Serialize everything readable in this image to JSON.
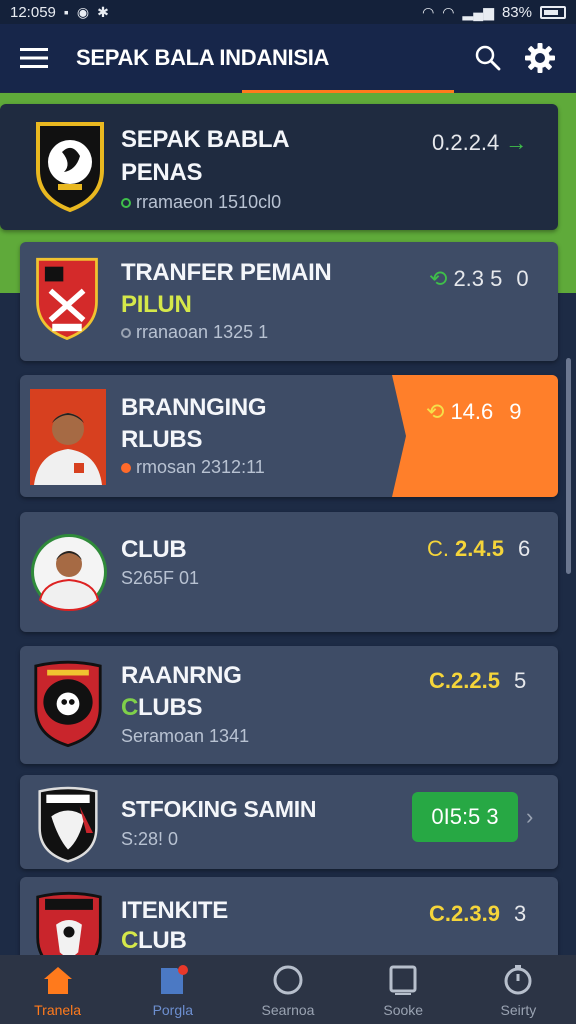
{
  "status_bar": {
    "time": "12:059",
    "battery": "83%"
  },
  "app_bar": {
    "title": "SEPAK BALA INDANISIA",
    "menu_icon": "hamburger-menu-icon",
    "search_icon": "search-icon",
    "settings_icon": "gear-icon"
  },
  "items": [
    {
      "name1": "SEPAK BABLA",
      "name2": "PENAS",
      "sub": "rramaeon 1510cl0",
      "score_a": "0.2.2.4",
      "score_b": "",
      "dot_color": "#3fbf4a",
      "badge": "black-gold-club-badge-icon"
    },
    {
      "name1": "TRANFER PEMAIN",
      "name2": "PILUN",
      "sub": "rranaoan 1325 1",
      "score_a": "2.3 5",
      "score_b": "0",
      "dot_color": "#9aa3b2",
      "badge": "red-shield-badge-icon"
    },
    {
      "name1": "BRANNGING",
      "name2": "RLUBS",
      "sub": "rmosan 2312:11",
      "score_a": "14.6",
      "score_b": "9",
      "dot_color": "#ff6a2a",
      "badge": "player-portrait-icon"
    },
    {
      "name1": "CLUB",
      "name2": "",
      "sub": "S265F 01",
      "score_a": "2.4.5",
      "score_b": "6",
      "dot_color": "",
      "badge": "player-portrait-icon"
    },
    {
      "name1": "RAANRNG",
      "name2": "CLUBS",
      "sub": "Seramoan 1341",
      "score_a": "C.2.2.5",
      "score_b": "5",
      "dot_color": "",
      "badge": "skull-club-badge-icon"
    },
    {
      "name1": "STFOKING SAMIN",
      "name2": "",
      "sub": "S:28! 0",
      "score_a": "0I5:5 3",
      "score_b": "",
      "dot_color": "",
      "badge": "white-eagle-badge-icon"
    },
    {
      "name1": "ITENKITE",
      "name2": "CLUB",
      "sub": "",
      "score_a": "C.2.3.9",
      "score_b": "3",
      "dot_color": "",
      "badge": "red-crest-badge-icon"
    }
  ],
  "nav": [
    {
      "label": "Tranela",
      "icon": "home-icon"
    },
    {
      "label": "Porgla",
      "icon": "document-icon"
    },
    {
      "label": "Searnoa",
      "icon": "circle-icon"
    },
    {
      "label": "Sooke",
      "icon": "box-icon"
    },
    {
      "label": "Seirty",
      "icon": "timer-icon"
    }
  ],
  "colors": {
    "accent": "#ff7a1c",
    "green": "#27a844",
    "highlight": "#5faa3a",
    "card": "#3e4c66",
    "background": "#1d2b45"
  }
}
